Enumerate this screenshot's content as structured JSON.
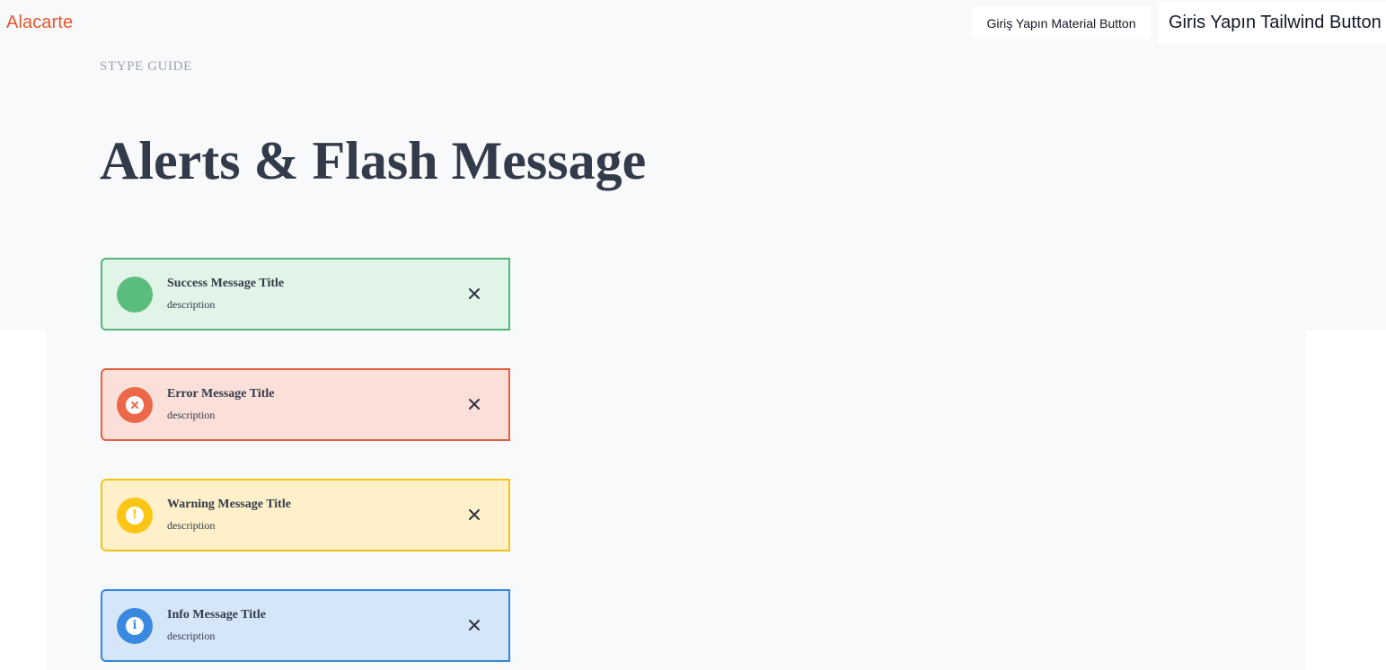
{
  "navbar": {
    "brand": "Alacarte",
    "material_button_label": "Giriş Yapın Material Button",
    "tailwind_button_label": "Giris Yapın Tailwind Button"
  },
  "header": {
    "eyebrow": "STYPE GUIDE",
    "title": "Alerts & Flash Message"
  },
  "alerts": [
    {
      "kind": "success",
      "title": "Success Message Title",
      "description": "description",
      "icon": "success-dot-icon",
      "colors": {
        "border": "#52b676",
        "background": "#e0f4e8",
        "icon": "#5bbd7d"
      }
    },
    {
      "kind": "error",
      "title": "Error Message Title",
      "description": "description",
      "icon": "x-circle-icon",
      "colors": {
        "border": "#e4613f",
        "background": "#fbdfd9",
        "icon": "#ec6848"
      }
    },
    {
      "kind": "warning",
      "title": "Warning Message Title",
      "description": "description",
      "icon": "exclamation-circle-icon",
      "colors": {
        "border": "#f3c316",
        "background": "#fef1c9",
        "icon": "#fac514"
      }
    },
    {
      "kind": "info",
      "title": "Info Message Title",
      "description": "description",
      "icon": "info-circle-icon",
      "colors": {
        "border": "#3386dc",
        "background": "#d6e6f9",
        "icon": "#3a89e1"
      }
    }
  ],
  "colors": {
    "brand": "#e4572e",
    "page_background": "#f8f9fb",
    "text": "#333b4a"
  }
}
